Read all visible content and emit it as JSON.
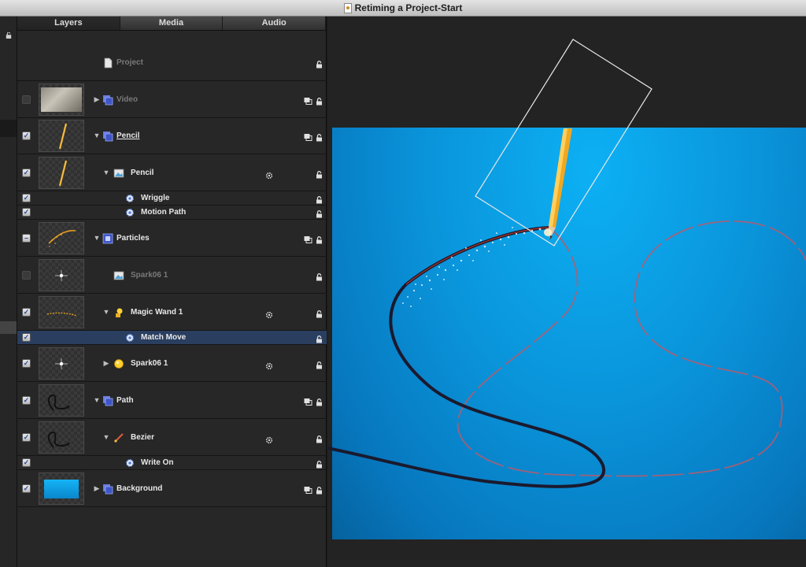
{
  "window": {
    "title": "Retiming a Project-Start"
  },
  "tabs": [
    {
      "label": "Layers",
      "active": true
    },
    {
      "label": "Media",
      "active": false
    },
    {
      "label": "Audio",
      "active": false
    }
  ],
  "layers": [
    {
      "label": "Project",
      "checked": null,
      "thumb": null,
      "expanded": null,
      "icon": "project-doc-icon",
      "dim": true,
      "gear": false,
      "stack": false,
      "lock": true
    },
    {
      "label": "Video",
      "checked": false,
      "thumb": "video-thumbnail",
      "expanded": false,
      "icon": "group-icon",
      "dim": true,
      "gear": false,
      "stack": true,
      "lock": true
    },
    {
      "label": "Pencil",
      "checked": true,
      "thumb": "pencil-thumbnail",
      "expanded": true,
      "icon": "group-icon",
      "underline": true,
      "gear": false,
      "stack": true,
      "lock": true
    },
    {
      "label": "Pencil",
      "checked": true,
      "thumb": "pencil-thumbnail",
      "expanded": true,
      "icon": "image-layer-icon",
      "gear": true,
      "stack": false,
      "lock": true
    },
    {
      "label": "Wriggle",
      "checked": true,
      "thumb": null,
      "expanded": null,
      "icon": "behavior-gear-icon",
      "gear": false,
      "stack": false,
      "lock": true
    },
    {
      "label": "Motion Path",
      "checked": true,
      "thumb": null,
      "expanded": null,
      "icon": "behavior-gear-icon",
      "gear": false,
      "stack": false,
      "lock": true
    },
    {
      "label": "Particles",
      "checked": "mixed",
      "thumb": "particles-thumbnail",
      "expanded": true,
      "icon": "particles-group-icon",
      "gear": false,
      "stack": true,
      "lock": true
    },
    {
      "label": "Spark06 1",
      "checked": false,
      "thumb": "spark-thumbnail",
      "expanded": null,
      "icon": "image-layer-icon",
      "dim": true,
      "gear": false,
      "stack": false,
      "lock": true
    },
    {
      "label": "Magic Wand 1",
      "checked": true,
      "thumb": "wand-thumbnail",
      "expanded": true,
      "icon": "emitter-icon",
      "gear": true,
      "stack": false,
      "lock": true
    },
    {
      "label": "Match Move",
      "checked": true,
      "thumb": null,
      "expanded": null,
      "icon": "behavior-gear-icon",
      "selected": true,
      "gear": false,
      "stack": false,
      "lock": true
    },
    {
      "label": "Spark06 1",
      "checked": true,
      "thumb": "spark-thumbnail",
      "expanded": false,
      "icon": "particle-cell-icon",
      "gear": true,
      "stack": false,
      "lock": true
    },
    {
      "label": "Path",
      "checked": true,
      "thumb": "path-thumbnail",
      "expanded": true,
      "icon": "group-icon",
      "gear": false,
      "stack": true,
      "lock": true
    },
    {
      "label": "Bezier",
      "checked": true,
      "thumb": "path-thumbnail",
      "expanded": true,
      "icon": "bezier-shape-icon",
      "gear": true,
      "stack": false,
      "lock": true
    },
    {
      "label": "Write On",
      "checked": true,
      "thumb": null,
      "expanded": null,
      "icon": "behavior-gear-icon",
      "gear": false,
      "stack": false,
      "lock": true
    },
    {
      "label": "Background",
      "checked": true,
      "thumb": "background-thumbnail",
      "expanded": false,
      "icon": "group-icon",
      "gear": false,
      "stack": true,
      "lock": true
    }
  ],
  "canvas": {
    "background_color": "#0a94da",
    "path_color": "#1a1a2e",
    "motion_path_color": "#b85a6a",
    "bounding_box_color": "#e8e8e8"
  }
}
